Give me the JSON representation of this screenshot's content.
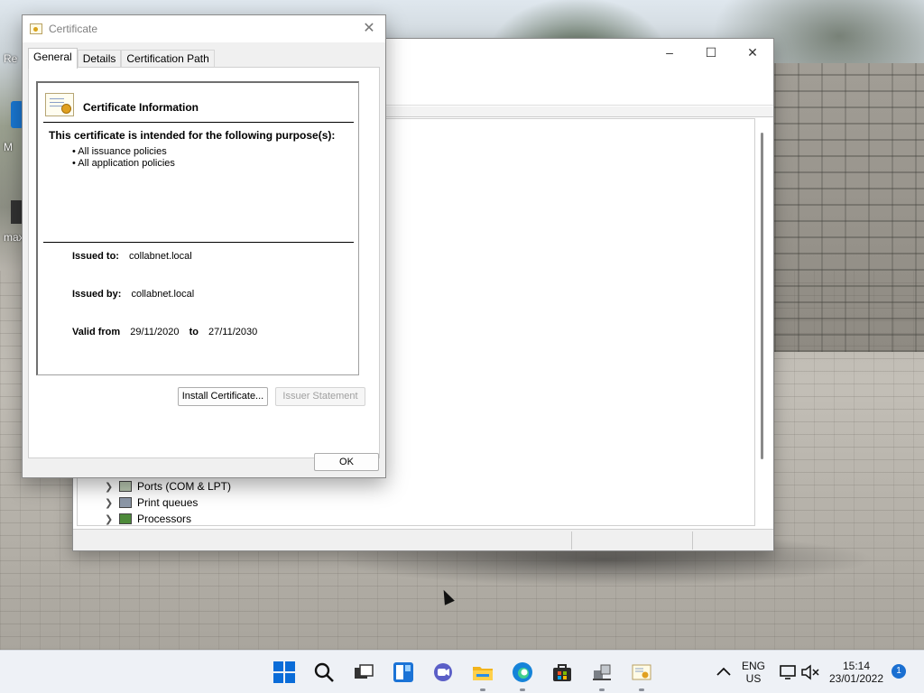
{
  "desktop": {
    "icons": [
      {
        "label": "Re"
      },
      {
        "label": "M"
      },
      {
        "label": "max"
      }
    ]
  },
  "device_manager": {
    "tree_items": [
      {
        "label": "Ports (COM & LPT)"
      },
      {
        "label": "Print queues"
      },
      {
        "label": "Processors"
      }
    ]
  },
  "certificate_dialog": {
    "title": "Certificate",
    "tabs": [
      {
        "label": "General",
        "active": true
      },
      {
        "label": "Details",
        "active": false
      },
      {
        "label": "Certification Path",
        "active": false
      }
    ],
    "info_title": "Certificate Information",
    "purpose_heading": "This certificate is intended for the following purpose(s):",
    "purposes": [
      "• All issuance policies",
      "• All application policies"
    ],
    "issued_to_label": "Issued to:",
    "issued_to": "collabnet.local",
    "issued_by_label": "Issued by:",
    "issued_by": "collabnet.local",
    "valid_from_label": "Valid from",
    "valid_from": "29/11/2020",
    "valid_to_label": "to",
    "valid_to": "27/11/2030",
    "install_button": "Install Certificate...",
    "issuer_statement_button": "Issuer Statement",
    "ok_button": "OK"
  },
  "taskbar": {
    "language": "ENG",
    "region": "US",
    "time": "15:14",
    "date": "23/01/2022",
    "notification_count": "1",
    "icons": [
      "start-icon",
      "search-icon",
      "task-view-icon",
      "widgets-icon",
      "chat-icon",
      "file-explorer-icon",
      "edge-icon",
      "store-icon",
      "network-app-icon",
      "certificate-app-icon"
    ]
  },
  "colors": {
    "accent": "#0a6cd8",
    "badge": "#1a6fd1",
    "disabled_text": "#a0a0a0"
  }
}
